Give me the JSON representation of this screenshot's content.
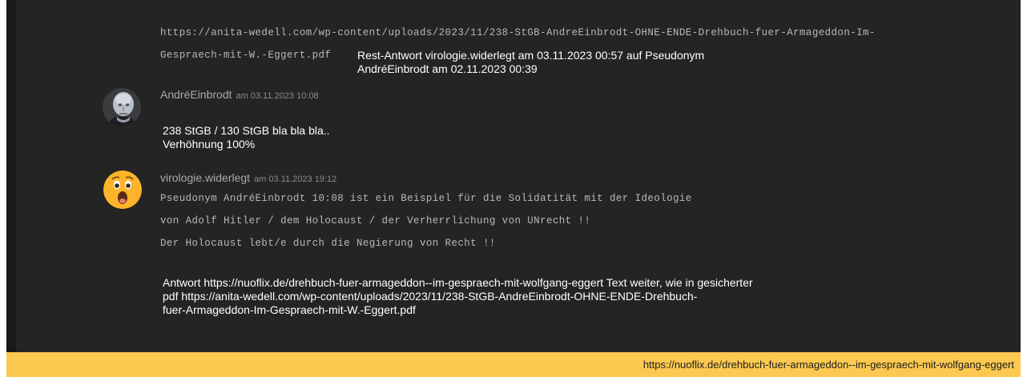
{
  "quote": {
    "url_line1": "https://anita-wedell.com/wp-content/uploads/2023/11/238-StGB-AndreEinbrodt-OHNE-ENDE-Drehbuch-fuer-Armageddon-Im-",
    "url_line2": "Gespraech-mit-W.-Eggert.pdf",
    "reply_line1": "Rest-Antwort virologie.widerlegt  am 03.11.2023 00:57 auf Pseudonym",
    "reply_line2": "AndréEinbrodt  am 02.11.2023 00:39"
  },
  "comments": [
    {
      "author": "AndréEinbrodt",
      "date": "am 03.11.2023 10:08",
      "avatar_icon": "bald-man-avatar",
      "lines": [
        "238 StGB / 130 StGB bla bla bla..",
        "Verhöhnung 100%"
      ]
    },
    {
      "author": "virologie.widerlegt",
      "date": "am 03.11.2023 19:12",
      "avatar_icon": "surprised-emoji-avatar",
      "mono_lines": [
        "Pseudonym AndréEinbrodt 10:08 ist ein Beispiel für die Solidatität mit der Ideologie",
        "von Adolf Hitler / dem Holocaust / der Verherrlichung von UNrecht !!",
        "Der Holocaust lebt/e durch die Negierung von Recht !!"
      ],
      "answer_lines": [
        "Antwort https://nuoflix.de/drehbuch-fuer-armageddon--im-gespraech-mit-wolfgang-eggert Text weiter, wie in gesicherter",
        "pdf https://anita-wedell.com/wp-content/uploads/2023/11/238-StGB-AndreEinbrodt-OHNE-ENDE-Drehbuch-",
        "fuer-Armageddon-Im-Gespraech-mit-W.-Eggert.pdf"
      ]
    }
  ],
  "footer": {
    "url": "https://nuoflix.de/drehbuch-fuer-armageddon--im-gespraech-mit-wolfgang-eggert"
  },
  "colors": {
    "panel": "#242424",
    "footer": "#fcc850"
  }
}
